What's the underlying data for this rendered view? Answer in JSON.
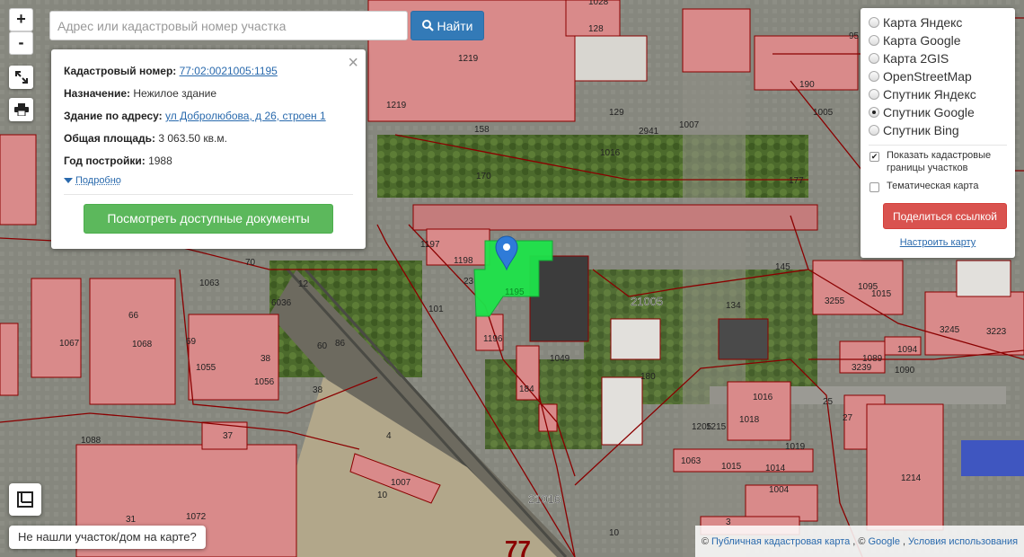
{
  "search": {
    "placeholder": "Адрес или кадастровый номер участка",
    "button_label": "Найти"
  },
  "zoom": {
    "in_label": "+",
    "out_label": "-"
  },
  "popup": {
    "close_label": "×",
    "cadastral_label": "Кадастровый номер:",
    "cadastral_value": "77:02:0021005:1195",
    "purpose_label": "Назначение:",
    "purpose_value": "Нежилое здание",
    "address_label": "Здание по адресу:",
    "address_value": "ул Добролюбова, д 26, строен 1",
    "area_label": "Общая площадь:",
    "area_value": "3 063.50 кв.м.",
    "year_label": "Год постройки:",
    "year_value": "1988",
    "more_label": "Подробно",
    "docs_button": "Посмотреть доступные документы"
  },
  "layers": {
    "options": [
      {
        "label": "Карта Яндекс",
        "selected": false
      },
      {
        "label": "Карта Google",
        "selected": false
      },
      {
        "label": "Карта 2GIS",
        "selected": false
      },
      {
        "label": "OpenStreetMap",
        "selected": false
      },
      {
        "label": "Спутник Яндекс",
        "selected": false
      },
      {
        "label": "Спутник Google",
        "selected": true
      },
      {
        "label": "Спутник Bing",
        "selected": false
      }
    ],
    "show_borders_label": "Показать кадастровые границы участков",
    "show_borders_checked": true,
    "thematic_label": "Тематическая карта",
    "thematic_checked": false,
    "share_button": "Поделиться ссылкой",
    "configure_link": "Настроить карту"
  },
  "notfound_label": "Не нашли участок/дом на карте?",
  "attribution": {
    "prefix": "©",
    "pkk_link": "Публичная кадастровая карта",
    "sep": ", ©",
    "google_link": "Google",
    "comma": ",",
    "terms_link": "Условия использования"
  },
  "map": {
    "selected_parcel_label": "1195",
    "district_labels": [
      "21005",
      "21016"
    ],
    "big_label": "77",
    "parcel_labels": [
      "1028",
      "128",
      "1219",
      "95",
      "190",
      "1005",
      "129",
      "1219",
      "158",
      "2941",
      "1007",
      "1016",
      "170",
      "177",
      "1197",
      "1198",
      "23",
      "101",
      "1196",
      "1049",
      "70",
      "1063",
      "6036",
      "12",
      "66",
      "1068",
      "1067",
      "69",
      "1055",
      "38",
      "1056",
      "60",
      "86",
      "38",
      "134",
      "3255",
      "1095",
      "1015",
      "3245",
      "3223",
      "1094",
      "3239",
      "1089",
      "1090",
      "180",
      "184",
      "1016",
      "1018",
      "25",
      "1205",
      "27",
      "1215",
      "1019",
      "1063",
      "1015",
      "1014",
      "1004",
      "1214",
      "1088",
      "37",
      "4",
      "1007",
      "10",
      "31",
      "1072",
      "3",
      "10",
      "145"
    ],
    "colors": {
      "parcel_border": "#8a0000",
      "building_fill": "#d98a8a",
      "selected_fill": "#1ee34a",
      "marker": "#2f7bd8"
    }
  }
}
